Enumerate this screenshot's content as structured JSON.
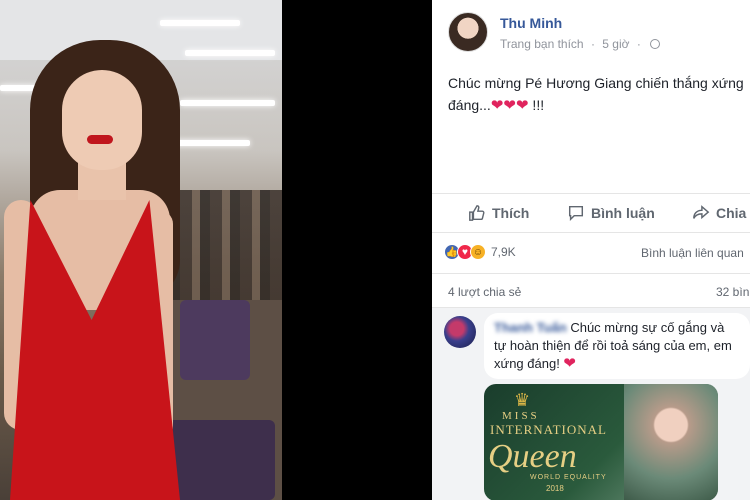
{
  "post": {
    "author": "Thu Minh",
    "meta": "Trang bạn thích",
    "time": "5 giờ",
    "text_line1": "Chúc mừng Pé Hương Giang chiến thắng xứng",
    "text_line2_prefix": "đáng...",
    "hearts": "❤❤❤",
    "text_line2_suffix": " !!!"
  },
  "actions": {
    "like": "Thích",
    "comment": "Bình luận",
    "share": "Chia"
  },
  "stats": {
    "reaction_count": "7,9K",
    "comments_link": "Bình luận liên quan",
    "shares": "4 lượt chia sẻ",
    "views": "32 bìn"
  },
  "comment": {
    "author": "Thanh Tuấn",
    "text": "Chúc mừng sự cố gắng và tự hoàn thiện để rồi toả sáng của em, em xứng đáng! ",
    "heart": "❤",
    "image_text": {
      "line1": "MISS",
      "line2": "INTERNATIONAL",
      "line3": "Queen",
      "line4": "WORLD EQUALITY",
      "year": "2018"
    }
  },
  "colors": {
    "link": "#365899",
    "muted": "#90949c",
    "like": "#4267b2",
    "love": "#f0284a",
    "haha": "#f7b125"
  }
}
